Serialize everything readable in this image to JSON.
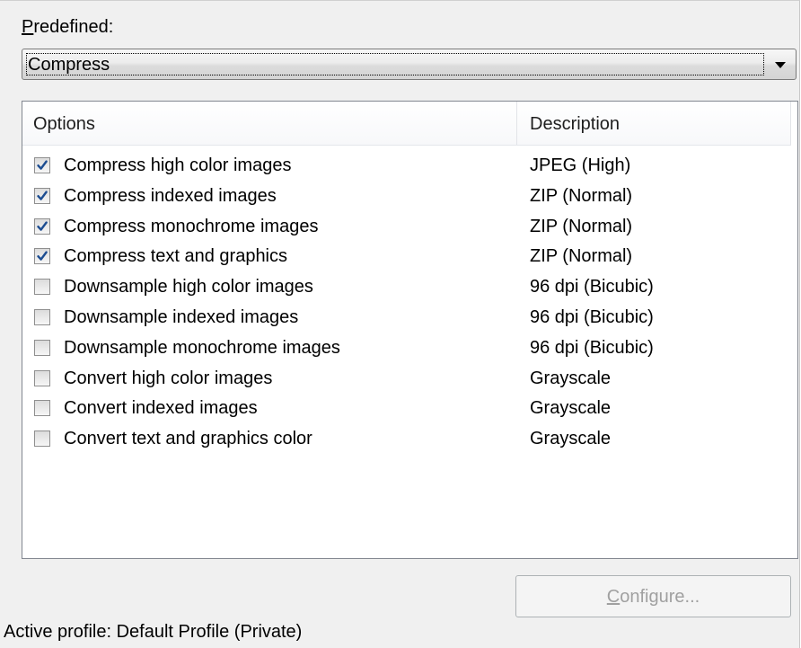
{
  "predefined": {
    "label_accel": "P",
    "label_rest": "redefined:",
    "selected": "Compress"
  },
  "list": {
    "columns": [
      "Options",
      "Description"
    ],
    "rows": [
      {
        "label": "Compress high color images",
        "description": "JPEG (High)",
        "checked": true
      },
      {
        "label": "Compress indexed images",
        "description": "ZIP (Normal)",
        "checked": true
      },
      {
        "label": "Compress monochrome images",
        "description": "ZIP (Normal)",
        "checked": true
      },
      {
        "label": "Compress text and graphics",
        "description": "ZIP (Normal)",
        "checked": true
      },
      {
        "label": "Downsample high color images",
        "description": "96 dpi (Bicubic)",
        "checked": false
      },
      {
        "label": "Downsample indexed images",
        "description": "96 dpi (Bicubic)",
        "checked": false
      },
      {
        "label": "Downsample monochrome images",
        "description": "96 dpi (Bicubic)",
        "checked": false
      },
      {
        "label": "Convert high color images",
        "description": "Grayscale",
        "checked": false
      },
      {
        "label": "Convert indexed images",
        "description": "Grayscale",
        "checked": false
      },
      {
        "label": "Convert text and graphics color",
        "description": "Grayscale",
        "checked": false
      }
    ]
  },
  "configure_button": {
    "label_accel": "C",
    "label_rest": "onfigure...",
    "enabled": false
  },
  "active_profile": "Active profile: Default Profile (Private)",
  "colors": {
    "dialog_background": "#f0f0f0",
    "checkmark": "#1d4d91",
    "disabled_text": "#a0a0a0"
  }
}
